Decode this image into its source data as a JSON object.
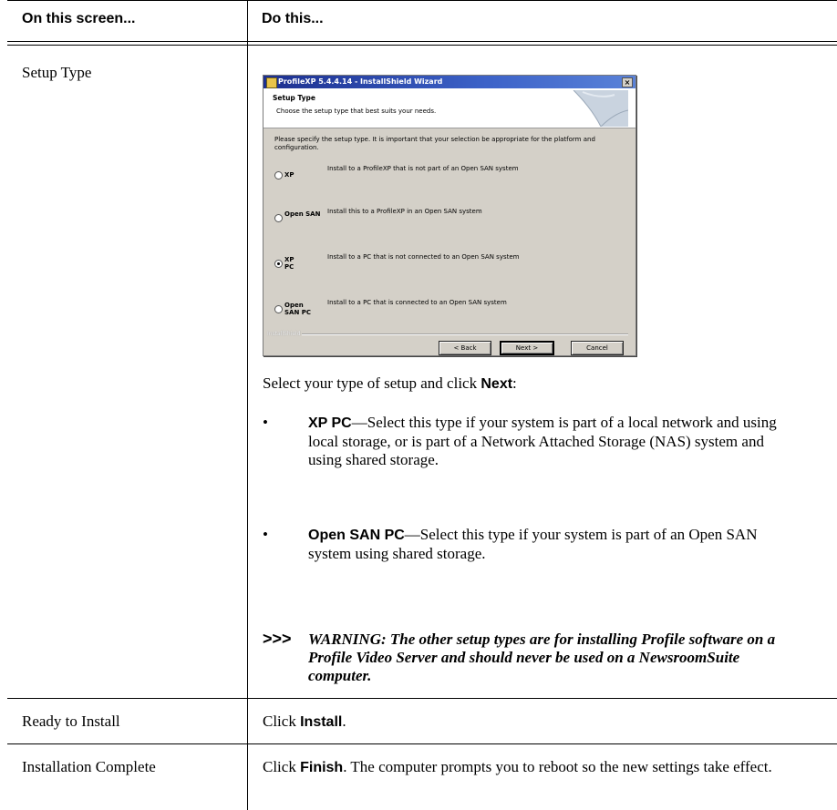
{
  "table": {
    "col1_header": "On this screen...",
    "col2_header": "Do this..."
  },
  "rows": [
    {
      "screen": "Setup Type",
      "intro_pre": "Select your type of setup and click ",
      "intro_bold": "Next",
      "intro_post": ":",
      "bullets": [
        {
          "bold": "XP PC",
          "text": "—Select this type if your system is part of a local network and using local storage, or is part of a Network Attached Storage (NAS) system and using shared storage."
        },
        {
          "bold": "Open SAN PC",
          "text": "—Select this type if your system is part of an Open SAN system using shared storage."
        }
      ],
      "warning_mark": ">>>",
      "warning_text": "WARNING: The other setup types are for installing Profile software on a Profile Video Server and should never be used on a NewsroomSuite computer."
    },
    {
      "screen": "Ready to Install",
      "pre": "Click ",
      "bold": "Install",
      "post": "."
    },
    {
      "screen": "Installation Complete",
      "pre": "Click ",
      "bold": "Finish",
      "post": ". The computer prompts you to reboot so the new settings take effect."
    }
  ],
  "dialog": {
    "title": "ProfileXP 5.4.4.14 - InstallShield Wizard",
    "close_glyph": "×",
    "banner_title": "Setup Type",
    "banner_subtitle": "Choose the setup type that best suits your needs.",
    "intro": "Please specify the setup type. It is important that your selection be appropriate for the platform and configuration.",
    "options": [
      {
        "label": "XP",
        "desc": "Install to a ProfileXP that is not part of an Open SAN system",
        "selected": false
      },
      {
        "label": "Open SAN",
        "desc": "Install this to a ProfileXP in an Open SAN system",
        "selected": false
      },
      {
        "label": "XP PC",
        "desc": "Install to a PC that is not connected to an Open SAN system",
        "selected": true
      },
      {
        "label": "Open SAN PC",
        "desc": "Install to a PC that is connected to an Open SAN system",
        "selected": false
      }
    ],
    "brand": "InstallShield",
    "back_label": "< Back",
    "next_label": "Next >",
    "cancel_label": "Cancel"
  }
}
